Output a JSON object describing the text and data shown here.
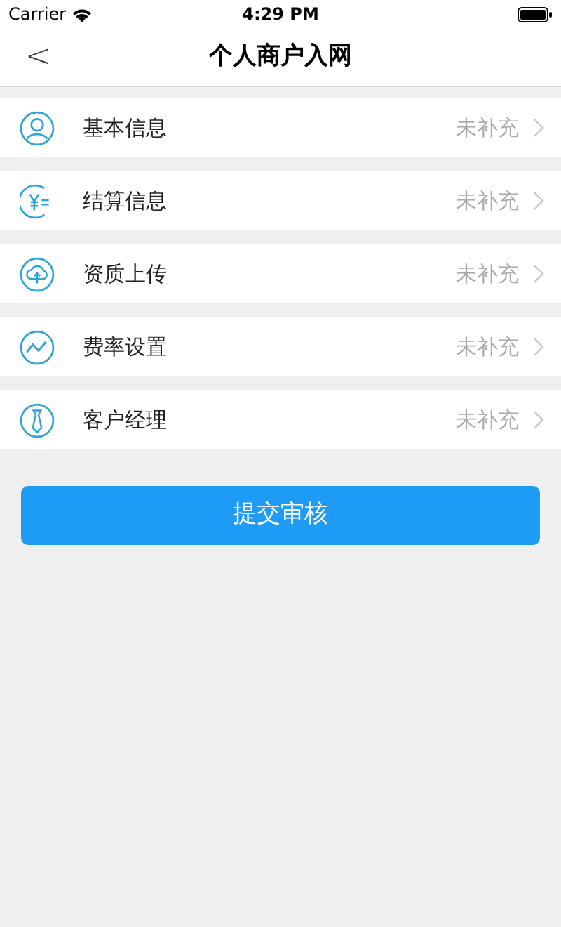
{
  "status_bar": {
    "carrier": "Carrier",
    "time": "4:29 PM"
  },
  "nav": {
    "back": "<",
    "title": "个人商户入网"
  },
  "items": [
    {
      "label": "基本信息",
      "status": "未补充"
    },
    {
      "label": "结算信息",
      "status": "未补充"
    },
    {
      "label": "资质上传",
      "status": "未补充"
    },
    {
      "label": "费率设置",
      "status": "未补充"
    },
    {
      "label": "客户经理",
      "status": "未补充"
    }
  ],
  "submit": "提交审核"
}
